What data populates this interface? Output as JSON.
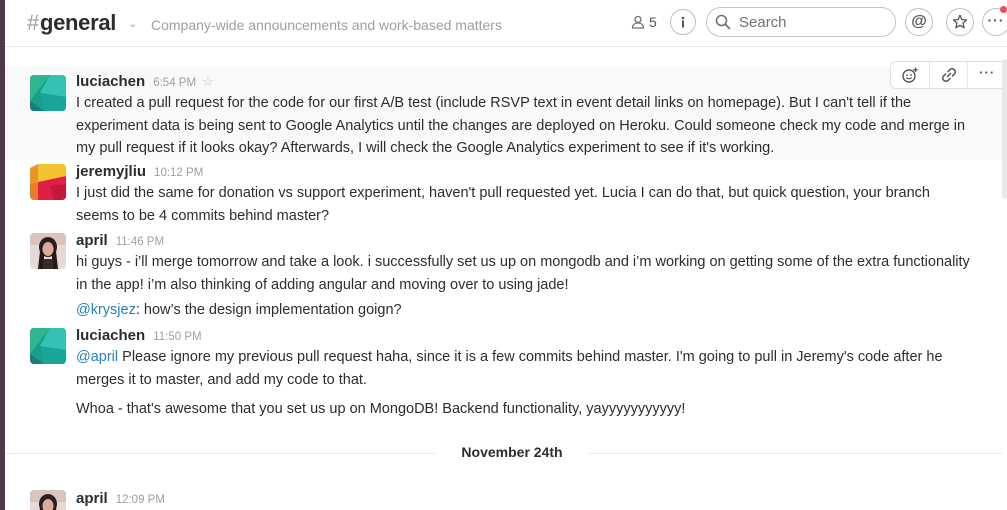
{
  "header": {
    "channel_hash": "#",
    "channel_name": "general",
    "caret": "⌄",
    "topic": "Company-wide announcements and work-based matters",
    "member_count": "5",
    "info_icon": "info-icon",
    "search_placeholder": "Search",
    "mention_icon": "at-icon",
    "star_icon": "star-icon",
    "more_icon": "more-icon",
    "notification_color": "#eb4d5c"
  },
  "messages": [
    {
      "user": "luciachen",
      "time": "6:54 PM",
      "star": "☆",
      "lines": [
        "I created a pull request for the code for our first A/B test (include RSVP text in event detail links on homepage). But I can't tell if the experiment data is being sent to Google Analytics until the changes are deployed on Heroku. Could someone check my code and merge in my pull request if it looks okay? Afterwards, I will check the Google Analytics experiment to see if it's working."
      ],
      "actions": [
        "add-reaction-icon",
        "link-icon",
        "more-icon"
      ]
    },
    {
      "user": "jeremyjliu",
      "time": "10:12 PM",
      "lines": [
        "I just did the same for donation vs support experiment, haven't pull requested yet. Lucia I can do that, but quick question, your branch seems to be 4 commits behind master?"
      ]
    },
    {
      "user": "april",
      "time": "11:46 PM",
      "lines": [
        "hi guys - i’ll merge tomorrow and take a look. i successfully set us up on mongodb and i’m working on getting some of the extra functionality in the app! i’m also thinking of adding angular and moving over to using jade!"
      ],
      "followup_mention": "@krysjez",
      "followup_text": ": how’s the design implementation goign?"
    },
    {
      "user": "luciachen",
      "time": "11:50 PM",
      "mention": "@april",
      "text_after_mention": " Please ignore my previous pull request haha, since it is a few commits behind master. I'm going to pull in Jeremy's code after he merges it to master, and add my code to that.",
      "followup_text": "Whoa - that's awesome that you set us up on MongoDB! Backend functionality, yayyyyyyyyyyy!"
    },
    {
      "user": "april",
      "time": "12:09 PM"
    }
  ],
  "day_divider": "November 24th",
  "colors": {
    "sidebar": "#4d394b",
    "link": "#2a80b9",
    "muted": "#9e9ea6"
  }
}
